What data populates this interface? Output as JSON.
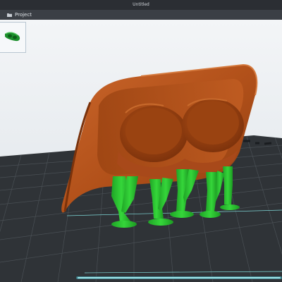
{
  "window": {
    "title": "Untitled"
  },
  "menubar": {
    "items": [
      {
        "label": "Project",
        "icon": "folder-icon"
      }
    ]
  },
  "object_list": {
    "items": [
      {
        "icon": "model-thumbnail-icon",
        "color": "#1c8f2c"
      }
    ]
  },
  "viewport": {
    "background_color": "#e9edf0",
    "bed_color": "#2f3337",
    "model_color": "#b6541a",
    "support_color": "#26c12c",
    "grid": true
  }
}
